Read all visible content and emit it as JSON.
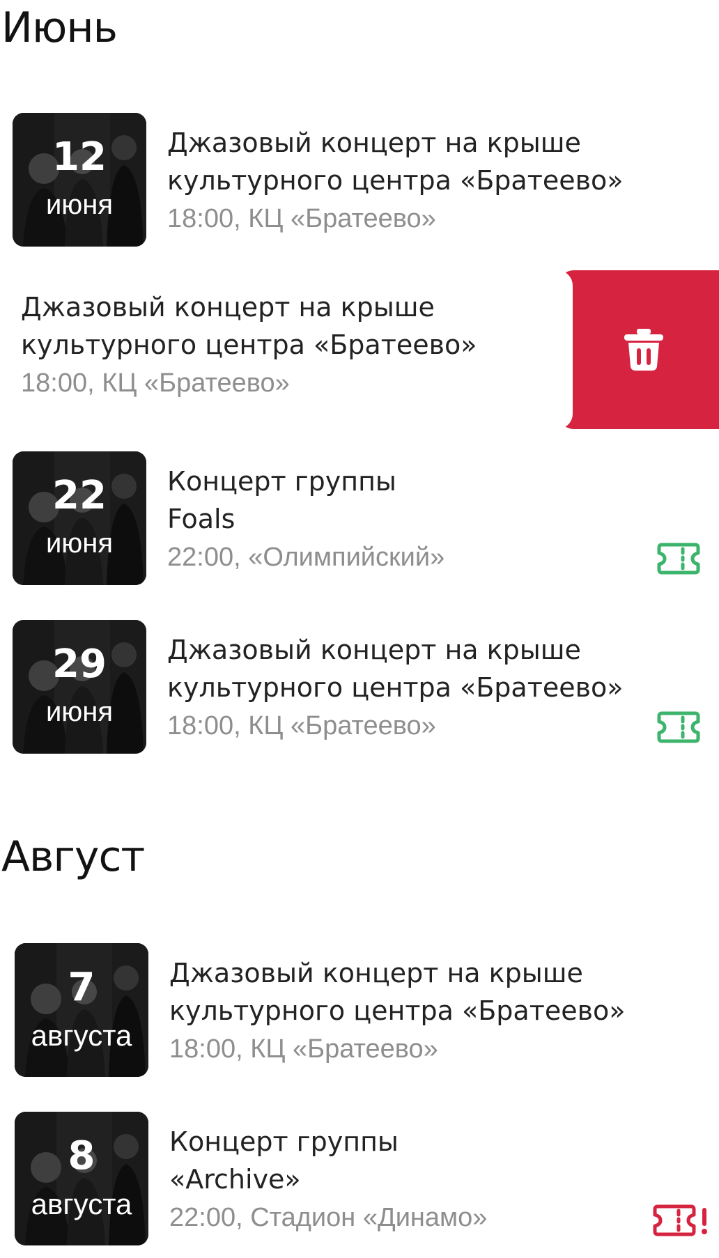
{
  "sections": [
    {
      "month": "Июнь",
      "events": [
        {
          "day": "12",
          "month_label": "июня",
          "title": "Джазовый концерт на крыше\nкультурного центра «Братеево»",
          "meta": "18:00, КЦ «Братеево»",
          "status": "none"
        },
        {
          "day": "",
          "month_label": "",
          "title": "Джазовый концерт на крыше\nкультурного центра «Братеево»",
          "meta": "18:00, КЦ «Братеево»",
          "status": "swiped-delete"
        },
        {
          "day": "22",
          "month_label": "июня",
          "title": "Концерт группы\nFoals",
          "meta": "22:00, «Олимпийский»",
          "status": "ticket-ok"
        },
        {
          "day": "29",
          "month_label": "июня",
          "title": "Джазовый концерт на крыше\nкультурного центра «Братеево»",
          "meta": "18:00, КЦ «Братеево»",
          "status": "ticket-ok"
        }
      ]
    },
    {
      "month": "Август",
      "events": [
        {
          "day": "7",
          "month_label": "августа",
          "title": "Джазовый концерт на крыше\nкультурного центра «Братеево»",
          "meta": "18:00, КЦ «Братеево»",
          "status": "none"
        },
        {
          "day": "8",
          "month_label": "августа",
          "title": "Концерт группы\n«Archive»",
          "meta": "22:00, Стадион «Динамо»",
          "status": "ticket-warning"
        }
      ]
    }
  ],
  "icons": {
    "ticket_ok": "ticket-icon",
    "ticket_warning": "ticket-alert-icon",
    "delete": "trash-icon"
  },
  "colors": {
    "delete_bg": "#d6233f",
    "ticket_ok": "#3cb46c",
    "ticket_warning": "#d6233f",
    "meta_text": "#8e8e8e"
  }
}
